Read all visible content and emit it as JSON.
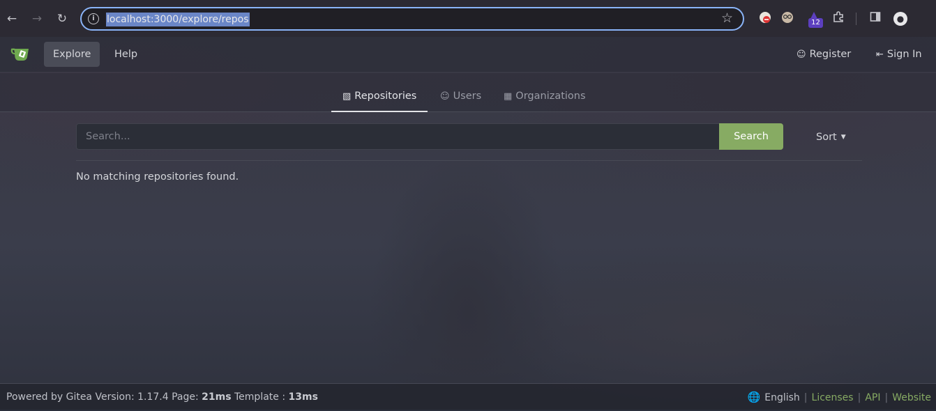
{
  "browser": {
    "url": "localhost:3000/explore/repos",
    "extension_badge": "12",
    "icons": [
      "back-icon",
      "forward-icon",
      "reload-icon",
      "info-icon",
      "star-icon",
      "extensions-icon",
      "sidepanel-icon",
      "profile-icon"
    ]
  },
  "navbar": {
    "explore_label": "Explore",
    "help_label": "Help",
    "register_label": "Register",
    "signin_label": "Sign In"
  },
  "tabs": {
    "repositories_label": "Repositories",
    "users_label": "Users",
    "organizations_label": "Organizations"
  },
  "search": {
    "placeholder": "Search...",
    "button_label": "Search",
    "sort_label": "Sort"
  },
  "main": {
    "empty_message": "No matching repositories found."
  },
  "footer": {
    "powered_by": "Powered by Gitea Version: 1.17.4 Page: ",
    "page_time": "21ms",
    "template_text": " Template : ",
    "template_time": "13ms",
    "language_label": "English",
    "licenses_label": "Licenses",
    "api_label": "API",
    "website_label": "Website"
  },
  "colors": {
    "accent_green": "#87ab63",
    "url_highlight": "#6a86c7",
    "omnibox_border": "#8ab4f8"
  }
}
